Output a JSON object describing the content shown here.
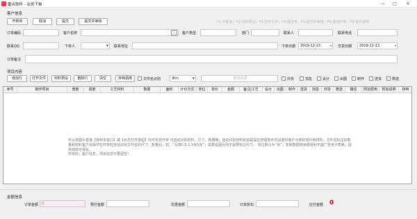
{
  "window": {
    "title": "雷点软件 - 业务下单",
    "minimize": "—",
    "maximize": "□",
    "close": "✕"
  },
  "customer_section": {
    "label": "客户信息",
    "buttons": [
      "开新单",
      "取消",
      "提交",
      "提交并审核"
    ],
    "shortcut_hint": "F1:开新单，F2:材料预设，F3:打开文件，F4:提交单，F5:提交并审核，F6:增加开单，F8:提示说明"
  },
  "fields": {
    "order_no_label": "订单编码",
    "customer_name_label": "客户名称",
    "customer_type_label": "客户类型",
    "department_label": "部门",
    "contact_label": "联系人",
    "contact_phone_label": "联系电话",
    "qq_label": "联系QQ",
    "placed_by_label": "下单人",
    "address_label": "联系地址",
    "order_date_label": "下单日期",
    "order_date_value": "2019-12-13",
    "delivery_date_label": "交货日期",
    "delivery_date_value": "2019-12-13",
    "remark_label": "订单备注"
  },
  "project_section": {
    "label": "项目内容",
    "buttons": [
      "增加行",
      "打开文件",
      "材料预设",
      "删除行",
      "清空",
      "存档调用"
    ],
    "filename_checkbox": "文件名识别",
    "unit_value": "米m",
    "search_placeholder": "查询内容",
    "process_checkboxes": [
      "外协",
      "加急",
      "设计",
      "出图",
      "制作",
      "送货",
      "赠送"
    ]
  },
  "table": {
    "columns": [
      "序号",
      "制作项目",
      "宽度",
      "高度",
      "工艺材料",
      "数量",
      "面积",
      "计价方式",
      "单位",
      "单价",
      "金额",
      "备注|工艺",
      "设计",
      "出图",
      "制作",
      "送货",
      "加急",
      "外协",
      "赠送",
      "路径",
      "附加费用",
      "附加说明",
      "存档"
    ]
  },
  "help": {
    "text": "可以将图片直接【拖到本窗口】或【点击打开按钮】均可实现开单 可自动识别材料、尺寸、数量等，自动识别材料的前提是在管理软件内设置好客户分类的单价和材料，文件名标注好数量和材料客户会操作在开单时自动识别文件名的尺寸、数量后，如：“写真0.5-1.5米5张”，如果是图片则不需要标注尺寸。  单位默认为“米”，复制数据使用很便利平面广告电子表格，提供高效可视化。",
    "text2": "开单时，客户信息，项目信息不要留空！"
  },
  "totals": {
    "label": "金额信息",
    "order_amount_label": "订单金额",
    "order_amount_value": "0",
    "prepaid_label": "预付金额",
    "discount_label": "优惠金额",
    "order_discount_label": "订单折扣",
    "payable_label": "应付金额",
    "payable_value": "0"
  },
  "colors": {
    "payable_red": "#e00000"
  }
}
